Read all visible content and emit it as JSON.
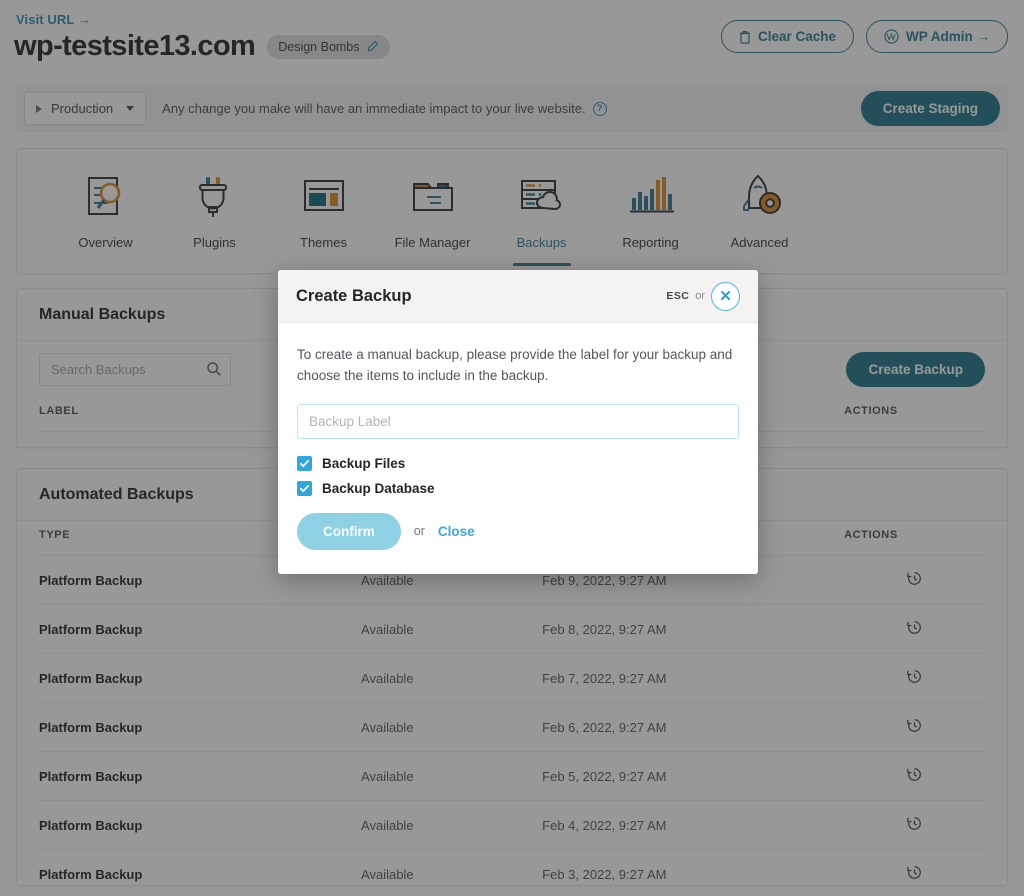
{
  "header": {
    "visit_url": "Visit URL →",
    "site_title": "wp-testsite13.com",
    "site_badge": "Design Bombs",
    "clear_cache": "Clear Cache",
    "wp_admin": "WP Admin →"
  },
  "env_bar": {
    "environment": "Production",
    "notice": "Any change you make will have an immediate impact to your live website.",
    "help": "?",
    "create_staging": "Create Staging"
  },
  "nav": {
    "items": [
      {
        "label": "Overview",
        "icon": "document-search-icon",
        "active": false
      },
      {
        "label": "Plugins",
        "icon": "plug-icon",
        "active": false
      },
      {
        "label": "Themes",
        "icon": "layout-icon",
        "active": false
      },
      {
        "label": "File Manager",
        "icon": "folder-icon",
        "active": false
      },
      {
        "label": "Backups",
        "icon": "server-cloud-icon",
        "active": true
      },
      {
        "label": "Reporting",
        "icon": "bar-chart-icon",
        "active": false
      },
      {
        "label": "Advanced",
        "icon": "rocket-gear-icon",
        "active": false
      }
    ]
  },
  "manual_backups": {
    "title": "Manual Backups",
    "search_placeholder": "Search Backups",
    "create_button": "Create Backup",
    "columns": [
      "LABEL",
      "",
      "",
      "ACTIONS"
    ],
    "rows": []
  },
  "automated_backups": {
    "title": "Automated Backups",
    "columns": [
      "TYPE",
      "",
      "",
      "ACTIONS"
    ],
    "rows": [
      {
        "type": "Platform Backup",
        "status": "Available",
        "date": "Feb 9, 2022, 9:27 AM",
        "action": "restore-icon"
      },
      {
        "type": "Platform Backup",
        "status": "Available",
        "date": "Feb 8, 2022, 9:27 AM",
        "action": "restore-icon"
      },
      {
        "type": "Platform Backup",
        "status": "Available",
        "date": "Feb 7, 2022, 9:27 AM",
        "action": "restore-icon"
      },
      {
        "type": "Platform Backup",
        "status": "Available",
        "date": "Feb 6, 2022, 9:27 AM",
        "action": "restore-icon"
      },
      {
        "type": "Platform Backup",
        "status": "Available",
        "date": "Feb 5, 2022, 9:27 AM",
        "action": "restore-icon"
      },
      {
        "type": "Platform Backup",
        "status": "Available",
        "date": "Feb 4, 2022, 9:27 AM",
        "action": "restore-icon"
      },
      {
        "type": "Platform Backup",
        "status": "Available",
        "date": "Feb 3, 2022, 9:27 AM",
        "action": "restore-icon"
      }
    ]
  },
  "modal": {
    "title": "Create Backup",
    "esc_key": "ESC",
    "esc_or": "or",
    "close_icon": "close-icon",
    "description": "To create a manual backup, please provide the label for your backup and choose the items to include in the backup.",
    "input_value": "",
    "input_placeholder": "Backup Label",
    "checkboxes": [
      {
        "label": "Backup Files",
        "checked": true
      },
      {
        "label": "Backup Database",
        "checked": true
      }
    ],
    "confirm_label": "Confirm",
    "or_label": "or",
    "close_label": "Close"
  },
  "colors": {
    "brand_teal": "#1d7489",
    "link_blue": "#2f8fb5",
    "accent_blue": "#2fa7de",
    "confirm_disabled": "#8ed1e5",
    "icon_orange": "#dd8a21",
    "page_bg": "#ffffff"
  }
}
